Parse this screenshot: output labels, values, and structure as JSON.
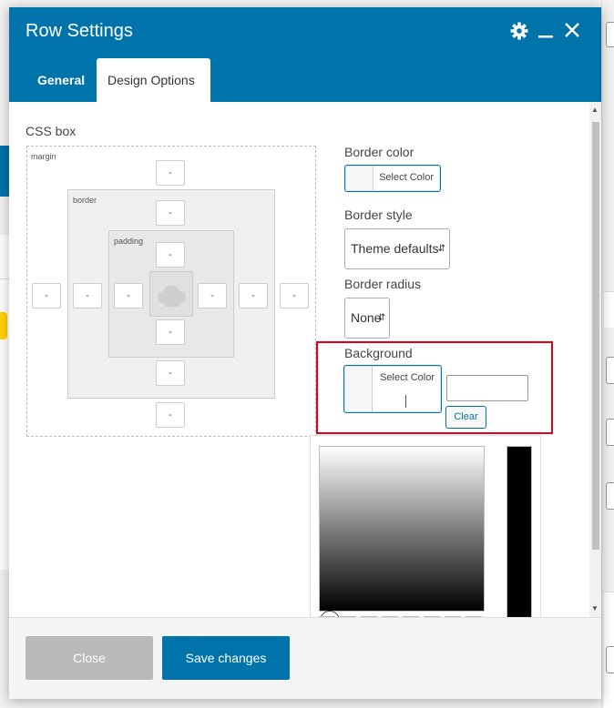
{
  "window": {
    "title": "Row Settings"
  },
  "tabs": [
    {
      "label": "General",
      "active": false
    },
    {
      "label": "Design Options",
      "active": true
    }
  ],
  "css_box": {
    "title": "CSS box",
    "margin_label": "margin",
    "border_label": "border",
    "padding_label": "padding",
    "margin": {
      "top": "-",
      "right": "-",
      "bottom": "-",
      "left": "-"
    },
    "border": {
      "top": "-",
      "right": "-",
      "bottom": "-",
      "left": "-"
    },
    "padding": {
      "top": "-",
      "right": "-",
      "bottom": "-",
      "left": "-"
    }
  },
  "border_color": {
    "label": "Border color",
    "button_label": "Select Color"
  },
  "border_style": {
    "label": "Border style",
    "value": "Theme defaults"
  },
  "border_radius": {
    "label": "Border radius",
    "value": "None"
  },
  "background": {
    "label": "Background",
    "button_label": "Select Color",
    "hex_value": "",
    "clear_label": "Clear"
  },
  "palette_colors": [
    "#000000",
    "#ffffff",
    "#dd3333",
    "#dd9933",
    "#eeee22",
    "#81d742",
    "#1e73be",
    "#8224e3"
  ],
  "footer": {
    "close_label": "Close",
    "save_label": "Save changes"
  },
  "colors": {
    "accent": "#0073aa",
    "highlight": "#e0001b"
  }
}
